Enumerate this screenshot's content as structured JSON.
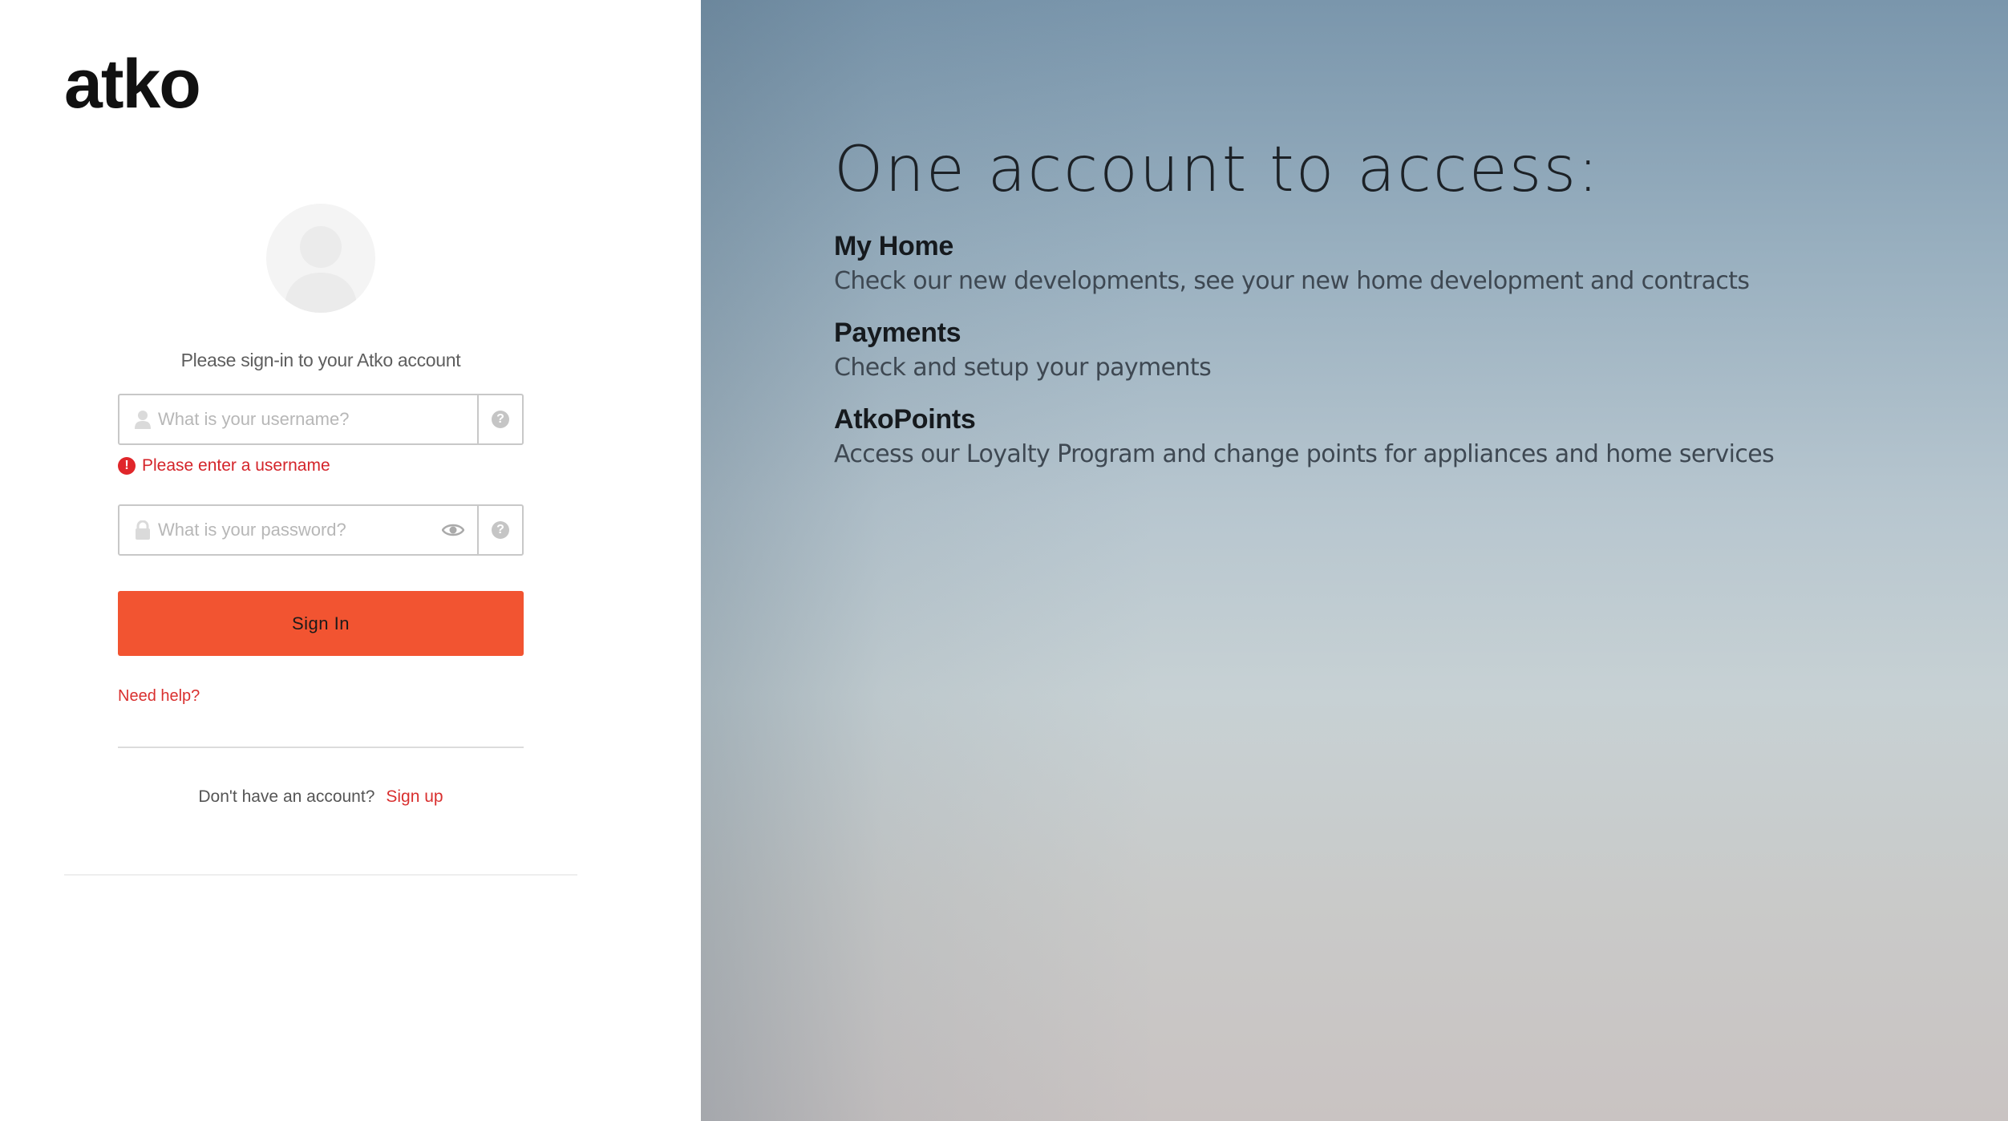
{
  "brand": {
    "logo_text": "atko"
  },
  "auth": {
    "subtitle": "Please sign-in to your Atko account",
    "username": {
      "placeholder": "What is your username?",
      "value": ""
    },
    "username_error": "Please enter a username",
    "password": {
      "placeholder": "What is your password?",
      "value": ""
    },
    "sign_in_label": "Sign In",
    "help_label": "Need help?",
    "no_account_text": "Don't have an account?",
    "sign_up_label": "Sign up"
  },
  "promo": {
    "title": "One account to access:",
    "features": [
      {
        "name": "My Home",
        "description": "Check our new developments, see your new home development and contracts"
      },
      {
        "name": "Payments",
        "description": "Check and setup your payments"
      },
      {
        "name": "AtkoPoints",
        "description": "Access our Loyalty Program and change points for appliances and home services"
      }
    ]
  },
  "colors": {
    "accent": "#f25431",
    "error": "#d4242a",
    "link": "#d9302f",
    "border": "#c8c8c8"
  },
  "icons": [
    "user-silhouette-icon",
    "user-icon",
    "lock-icon",
    "eye-icon",
    "help-icon",
    "error-icon"
  ]
}
